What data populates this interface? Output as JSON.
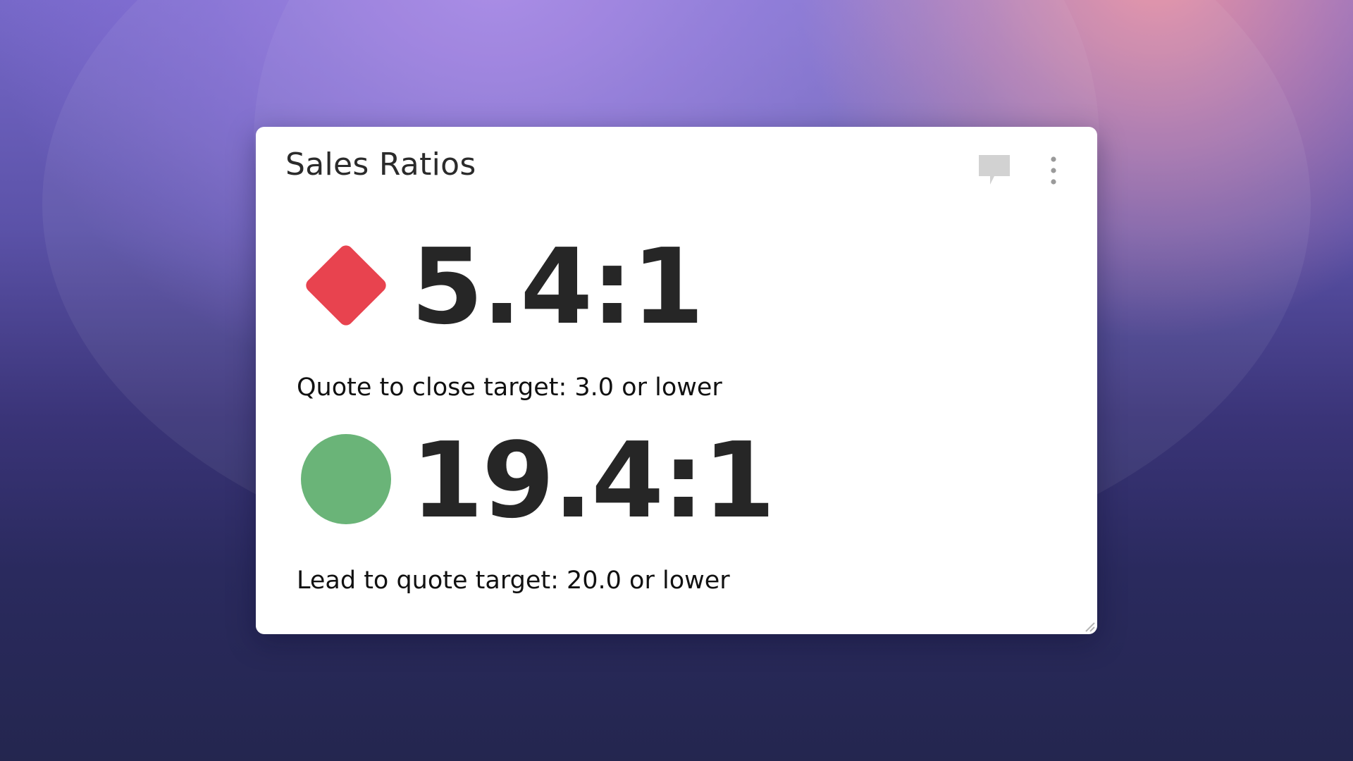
{
  "widget": {
    "title": "Sales Ratios",
    "actions": {
      "comment_icon": "speech-bubble-icon",
      "menu_icon": "vertical-ellipsis-icon"
    },
    "metrics": [
      {
        "value": "5.4:1",
        "caption": "Quote to close target: 3.0 or lower",
        "status": "bad",
        "indicator_icon": "red-diamond-icon",
        "indicator_color": "#e8434f"
      },
      {
        "value": "19.4:1",
        "caption": "Lead to quote target: 20.0 or lower",
        "status": "good",
        "indicator_icon": "green-circle-icon",
        "indicator_color": "#6ab478"
      }
    ]
  }
}
